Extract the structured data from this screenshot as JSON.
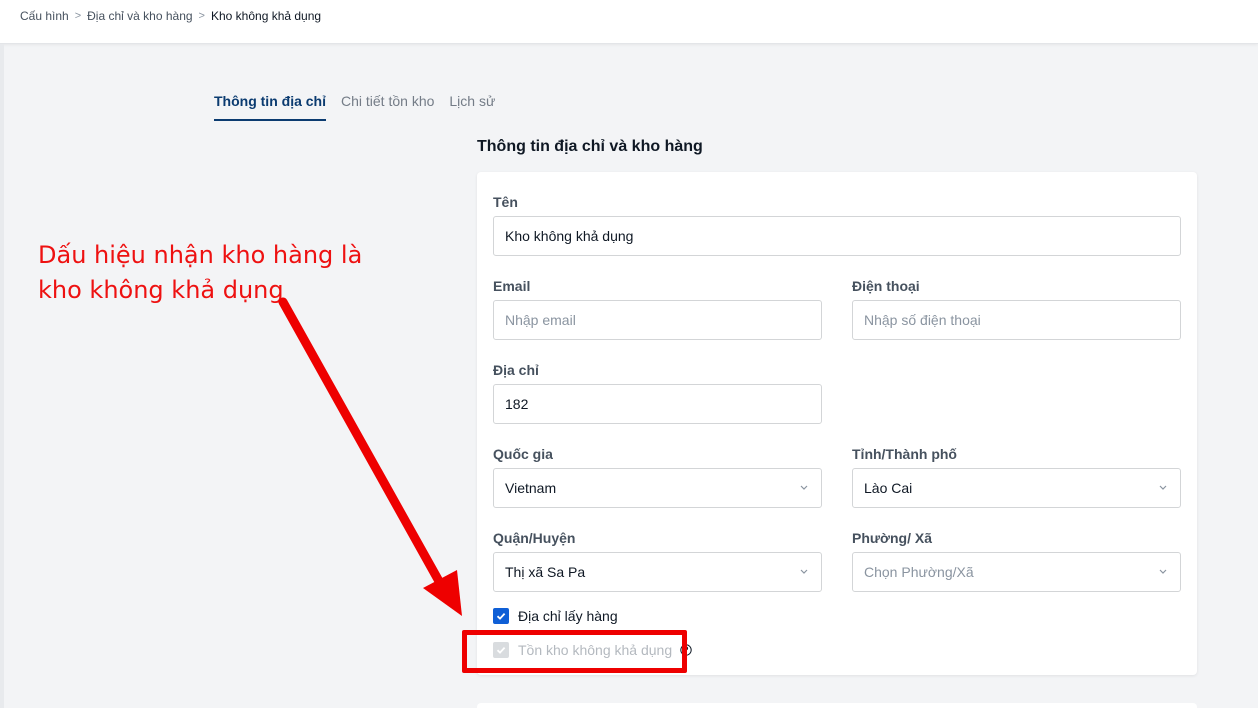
{
  "breadcrumb": {
    "items": [
      "Cấu hình",
      "Địa chỉ và kho hàng"
    ],
    "current": "Kho không khả dụng",
    "separator": ">"
  },
  "tabs": [
    {
      "label": "Thông tin địa chỉ",
      "active": true
    },
    {
      "label": "Chi tiết tồn kho",
      "active": false
    },
    {
      "label": "Lịch sử",
      "active": false
    }
  ],
  "section_title": "Thông tin địa chỉ và kho hàng",
  "form": {
    "name": {
      "label": "Tên",
      "value": "Kho không khả dụng"
    },
    "email": {
      "label": "Email",
      "placeholder": "Nhập email"
    },
    "phone": {
      "label": "Điện thoại",
      "placeholder": "Nhập số điện thoại"
    },
    "address": {
      "label": "Địa chỉ",
      "value": "182"
    },
    "country": {
      "label": "Quốc gia",
      "value": "Vietnam"
    },
    "province": {
      "label": "Tỉnh/Thành phố",
      "value": "Lào Cai"
    },
    "district": {
      "label": "Quận/Huyện",
      "value": "Thị xã Sa Pa"
    },
    "ward": {
      "label": "Phường/ Xã",
      "placeholder": "Chọn Phường/Xã"
    },
    "pickup_address": {
      "label": "Địa chỉ lấy hàng",
      "checked": true
    },
    "unavailable_stock": {
      "label": "Tồn kho không khả dụng",
      "checked": true,
      "disabled": true
    }
  },
  "annotation": {
    "line1": "Dấu hiệu nhận kho hàng là",
    "line2": "kho không khả dụng"
  },
  "colors": {
    "accent": "#0f5fd6",
    "tab_active": "#0b3b70",
    "annotation": "#ee1111"
  }
}
